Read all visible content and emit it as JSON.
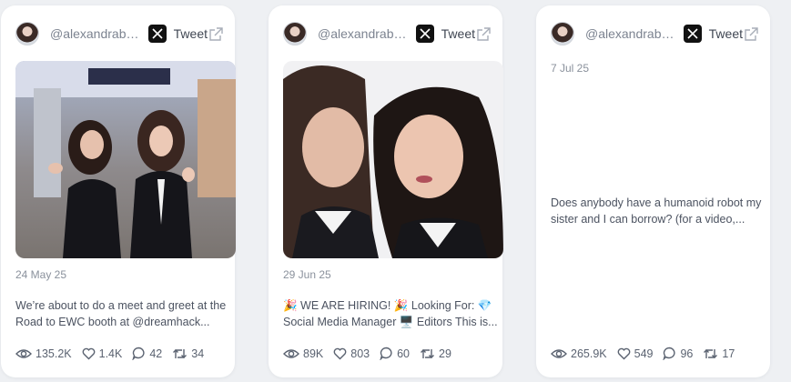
{
  "cards": [
    {
      "handle": "@alexandrabo...",
      "tweet_label": "Tweet",
      "date": "24 May 25",
      "text": "We’re about to do a meet and greet at the Road to EWC booth at @dreamhack...",
      "views": "135.2K",
      "likes": "1.4K",
      "replies": "42",
      "retweets": "34",
      "has_image": true
    },
    {
      "handle": "@alexandrabo...",
      "tweet_label": "Tweet",
      "date": "29 Jun 25",
      "text": "🎉 WE ARE HIRING! 🎉 Looking For: 💎 Social Media Manager 🖥️ Editors This is...",
      "views": "89K",
      "likes": "803",
      "replies": "60",
      "retweets": "29",
      "has_image": true
    },
    {
      "handle": "@alexandrabo...",
      "tweet_label": "Tweet",
      "date": "7 Jul 25",
      "text": "Does anybody have a humanoid robot my sister and I can borrow? (for a video,...",
      "views": "265.9K",
      "likes": "549",
      "replies": "96",
      "retweets": "17",
      "has_image": false
    }
  ],
  "icons": {
    "x_logo": "x-logo-icon",
    "external": "external-link-icon",
    "views": "eye-icon",
    "likes": "heart-icon",
    "replies": "comment-icon",
    "retweets": "retweet-icon"
  },
  "colors": {
    "background": "#eef0f3",
    "card": "#ffffff",
    "text": "#4b5260",
    "muted": "#8a919c"
  }
}
